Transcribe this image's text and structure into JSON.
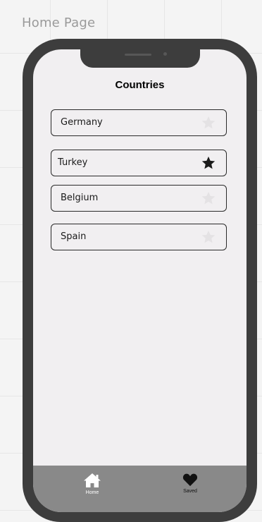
{
  "canvas": {
    "label": "Home Page"
  },
  "screen": {
    "title": "Countries"
  },
  "countries": [
    {
      "name": "Germany",
      "starred": false
    },
    {
      "name": "Turkey",
      "starred": true
    },
    {
      "name": "Belgium",
      "starred": false
    },
    {
      "name": "Spain",
      "starred": false
    }
  ],
  "nav": {
    "home_label": "Home",
    "saved_label": "Saved"
  },
  "icons": {
    "star_filled": "star-icon",
    "star_empty": "star-icon",
    "home": "house-icon",
    "saved": "heart-icon"
  },
  "colors": {
    "star_filled": "#1a1a1a",
    "star_empty": "#e4e2e4",
    "nav_background": "#898989",
    "frame": "#3d3d3d",
    "screen": "#f1eff1"
  }
}
